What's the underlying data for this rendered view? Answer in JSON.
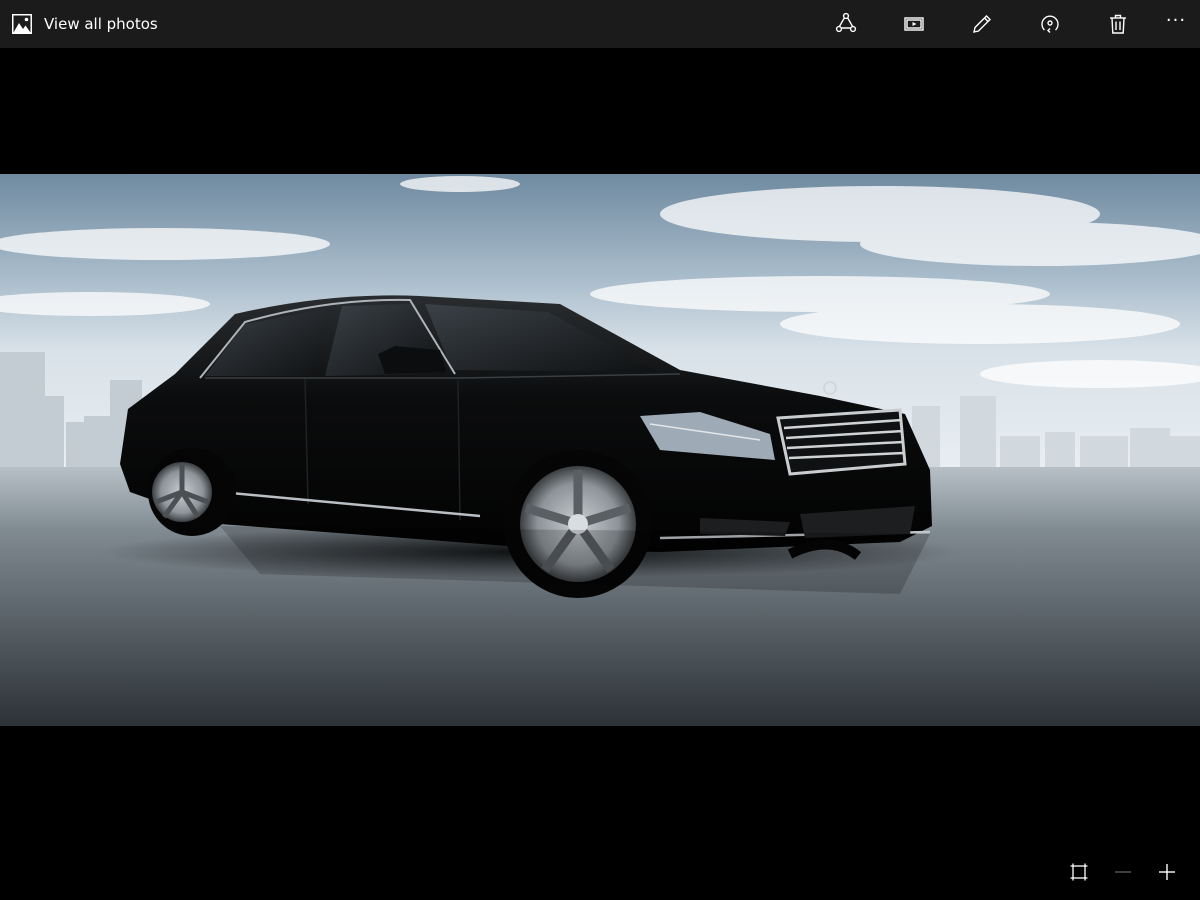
{
  "titlebar": {
    "view_all_label": "View all photos",
    "view_all_icon": "photo-icon"
  },
  "toolbar": {
    "buttons": [
      {
        "name": "share-icon"
      },
      {
        "name": "slideshow-icon"
      },
      {
        "name": "edit-icon"
      },
      {
        "name": "rotate-icon"
      },
      {
        "name": "delete-icon"
      },
      {
        "name": "more-icon",
        "glyph": "···"
      }
    ]
  },
  "photo": {
    "subject": "car-photo"
  },
  "zoom": {
    "buttons": [
      {
        "name": "fit-to-screen-icon"
      },
      {
        "name": "zoom-out-icon"
      },
      {
        "name": "zoom-in-icon"
      }
    ]
  },
  "colors": {
    "titlebar_bg": "#1b1b1b",
    "canvas_bg": "#000000",
    "icon": "#ffffff",
    "disabled_icon": "#5a5a5a"
  }
}
